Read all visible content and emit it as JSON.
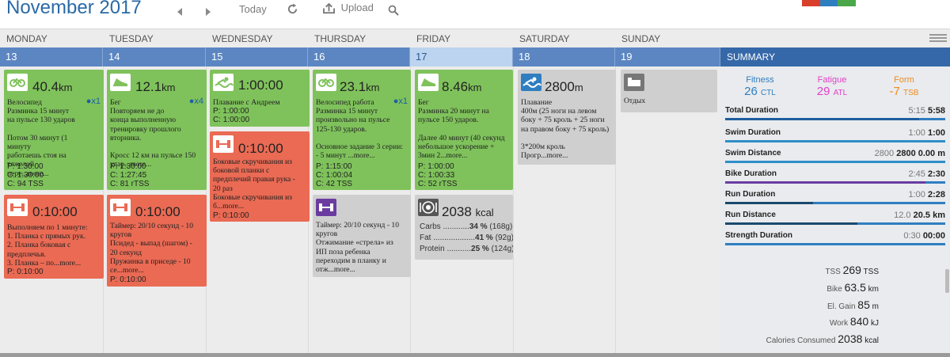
{
  "header": {
    "month": "November",
    "year": "2017",
    "today_label": "Today",
    "upload_label": "Upload",
    "brand_colors": [
      "#d9402b",
      "#2f7ec0",
      "#4aa84a"
    ]
  },
  "weekdays": [
    "MONDAY",
    "TUESDAY",
    "WEDNESDAY",
    "THURSDAY",
    "FRIDAY",
    "SATURDAY",
    "SUNDAY"
  ],
  "dates": [
    "13",
    "14",
    "15",
    "16",
    "17",
    "18",
    "19"
  ],
  "summary_title": "SUMMARY",
  "cards": {
    "mon_ride": {
      "value": "40.4",
      "unit": "km",
      "rep": "x1",
      "desc": "Велосипед\nРазминка 15 минут\nна пульсе 130 ударов\n\nПотом 30 минут (1 минуту\nработаешь стоя на тяжелой\nпере...",
      "more": "more...",
      "meta": "P: 1:30:00\nC: 1:30:00\nC: 94 TSS"
    },
    "mon_strength": {
      "value": "0:10:00",
      "desc": "Выполняем по 1 минуте:\n1. Планка с прямых рук.\n2. Планка боковая с\nпредплечья.\n3. Планка – по...",
      "more": "more...",
      "meta": "P: 0:10:00"
    },
    "tue_run": {
      "value": "12.1",
      "unit": "km",
      "rep": "x4",
      "desc": "Бег\nПовторяем не до\nконца выполненную\nтренировку прошлого\nвторника.\n\nКросс 12 км на пульсе 150\nудар...",
      "more": "more...",
      "meta": "P: 1:30:00\nC: 1:27:45\nC: 81 rTSS"
    },
    "tue_strength": {
      "value": "0:10:00",
      "desc": "Таймер: 20/10 секунд - 10\nкругов\nПсидед - выпад (шагом) -\n20 секунд\nПружинка в приседе - 10\nсе...",
      "more": "more...",
      "meta": "P: 0:10:00"
    },
    "wed_swim": {
      "value": "1:00:00",
      "desc": "Плавание с Андреем",
      "meta": "P: 1:00:00\nC: 1:00:00"
    },
    "wed_strength": {
      "value": "0:10:00",
      "desc": "Боковые скручивания из\nбоковой планки с\nпредплечий правая рука -\n20 раз\nБоковые скручивания из\nб...",
      "more": "more...",
      "meta": "P: 0:10:00"
    },
    "thu_ride": {
      "value": "23.1",
      "unit": "km",
      "rep": "x1",
      "desc": "Велосипед работа\nРазминка 15 минут\nпроизвольно на пульсе\n125-130 ударов.\n\nОсновное задание 3 серии:\n - 5 минут ...",
      "more": "more...",
      "meta": "P: 1:15:00\nC: 1:00:04\nC: 42 TSS"
    },
    "thu_strength": {
      "desc": "Таймер: 20/10 секунд - 10\nкругов\nОтжимание «стрела» из\nИП поза ребенка\nпереходим в планку и\nотж...",
      "more": "more..."
    },
    "fri_run": {
      "value": "8.46",
      "unit": "km",
      "desc": "Бег\nРазминка 20 минут на\nпульсе 150 ударов.\n\nДалее 40 минут (40 секунд\nнебольшое ускорение +\n3мин 2...",
      "more": "more...",
      "meta": "P: 1:00:00\nC: 1:00:33\nC: 52 rTSS"
    },
    "fri_nutrition": {
      "value": "2038",
      "unit": "kcal",
      "rows": [
        {
          "label": "Carbs",
          "dots": "............",
          "pct": "34 %",
          "g": "(168g)",
          "share": 0.34
        },
        {
          "label": "Fat",
          "dots": "...................",
          "pct": "41 %",
          "g": "(92g)",
          "share": 0.41
        },
        {
          "label": "Protein",
          "dots": "...........",
          "pct": "25 %",
          "g": "(124g)",
          "share": 0.25
        }
      ]
    },
    "sat_swim": {
      "value": "2800",
      "unit": "m",
      "desc": "Плавание\n400м (25 ноги на левом\nбоку + 75 кроль + 25 ноги\nна правом боку + 75 кроль)\n\n3*200м кроль\nПрогр...",
      "more": "more..."
    },
    "sun_rest": {
      "desc": "Отдых"
    }
  },
  "summary": {
    "fitness": {
      "label": "Fitness",
      "value": "26",
      "unit": "CTL",
      "color": "#2f7ec0"
    },
    "fatigue": {
      "label": "Fatigue",
      "value": "29",
      "unit": "ATL",
      "color": "#e040c8"
    },
    "form": {
      "label": "Form",
      "value": "-7",
      "unit": "TSB",
      "color": "#f08a1c"
    },
    "rows": [
      {
        "label": "Total Duration",
        "planned": "5:15",
        "actual": "5:58",
        "fill": 0.88,
        "color": "#1f5d9e"
      },
      {
        "label": "Swim Duration",
        "planned": "1:00",
        "actual": "1:00",
        "fill": 1.0,
        "color": "#2f8ec9"
      },
      {
        "label": "Swim Distance",
        "planned": "2800",
        "actual": "2800 0.00 m",
        "fill": 1.0,
        "color": "#2f8ec9"
      },
      {
        "label": "Bike Duration",
        "planned": "2:45",
        "actual": "2:30",
        "fill": 0.91,
        "color": "#6a3ca0"
      },
      {
        "label": "Run Duration",
        "planned": "1:00",
        "actual": "2:28",
        "fill": 0.4,
        "color": "#1a4a6e"
      },
      {
        "label": "Run Distance",
        "planned": "12.0",
        "actual": "20.5 km",
        "fill": 0.6,
        "color": "#1a4a6e"
      },
      {
        "label": "Strength Duration",
        "planned": "0:30",
        "actual": "00:00",
        "fill": 0,
        "color": "#2f8ec9"
      }
    ],
    "totals": [
      {
        "label": "TSS",
        "value": "269",
        "unit": "TSS"
      },
      {
        "label": "Bike",
        "value": "63.5",
        "unit": "km"
      },
      {
        "label": "El. Gain",
        "value": "85",
        "unit": "m"
      },
      {
        "label": "Work",
        "value": "840",
        "unit": "kJ"
      },
      {
        "label": "Calories Consumed",
        "value": "2038",
        "unit": "kcal"
      }
    ]
  }
}
